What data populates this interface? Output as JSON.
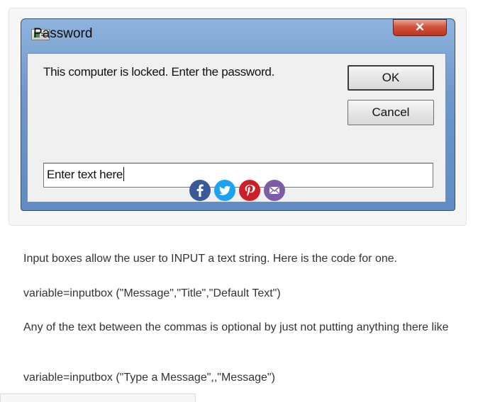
{
  "dialog": {
    "title": "Password",
    "close_symbol": "✕",
    "message": "This computer is locked. Enter the password.",
    "ok_label": "OK",
    "cancel_label": "Cancel",
    "input_value": "Enter text here"
  },
  "share": {
    "icons": [
      "facebook-icon",
      "twitter-icon",
      "pinterest-icon",
      "email-icon"
    ],
    "colors": {
      "facebook": "#3b5998",
      "twitter": "#1da1f2",
      "pinterest": "#cb2027",
      "email": "#7d5ba6"
    }
  },
  "article": {
    "p1": "Input boxes allow the user to INPUT a text string. Here is the code for one.",
    "p2": "variable=inputbox (\"Message\",\"Title\",\"Default Text\")",
    "p3": "Any of the text between the commas is optional by just not putting anything there like",
    "p4": "variable=inputbox (\"Type a Message\",,\"Message\")"
  }
}
